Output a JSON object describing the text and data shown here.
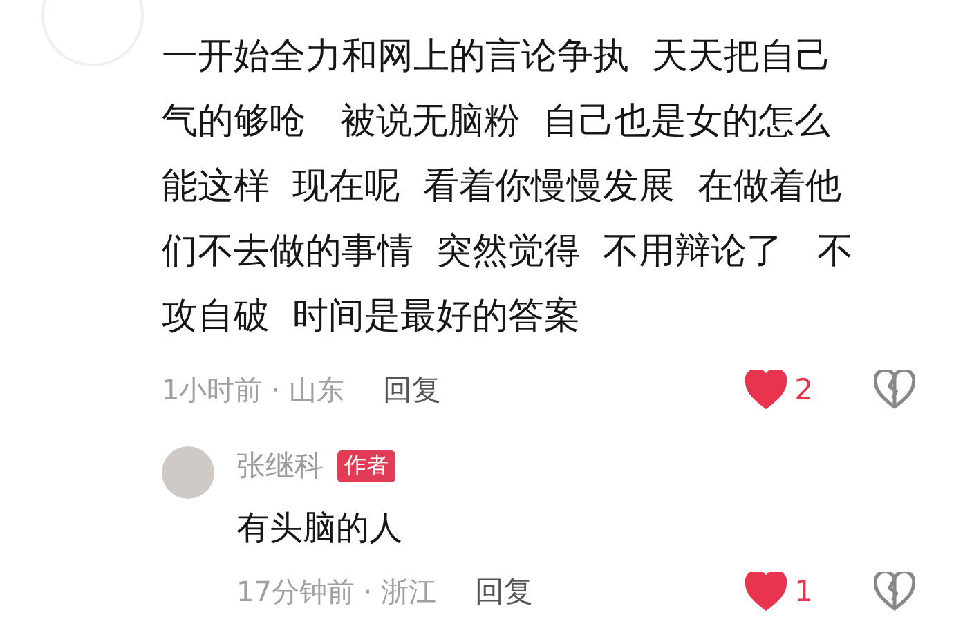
{
  "comment": {
    "text_lines": [
      "一开始全力和网上的言论争执  天天把自己",
      "气的够呛   被说无脑粉  自己也是女的怎么",
      "能这样  现在呢  看着你慢慢发展  在做着他",
      "们不去做的事情  突然觉得  不用辩论了   不",
      "攻自破  时间是最好的答案"
    ],
    "meta": "1小时前 · 山东",
    "reply_label": "回复",
    "liked": true,
    "like_count": "2",
    "reply": {
      "author": "张继科",
      "badge": "作者",
      "text": "有头脑的人",
      "meta": "17分钟前 · 浙江",
      "reply_label": "回复",
      "liked": true,
      "like_count": "1"
    }
  }
}
